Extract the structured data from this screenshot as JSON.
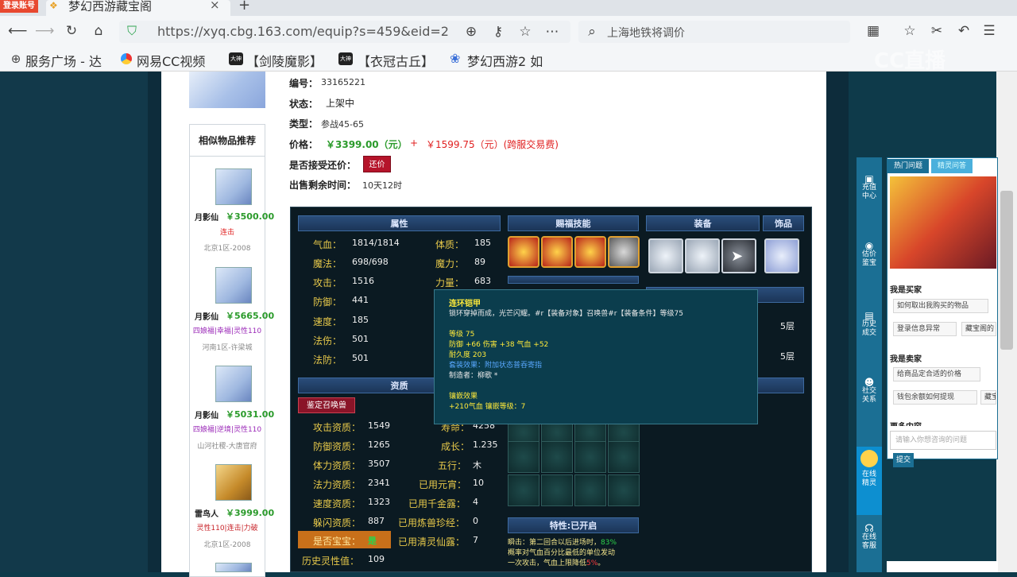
{
  "browser": {
    "tab_title": "梦幻西游藏宝阁",
    "login_badge": "登录账号",
    "url": "https://xyq.cbg.163.com/equip?s=459&eid=2",
    "search_text": "上海地铁将调价",
    "bookmarks": [
      "服务广场 - 达",
      "网易CC视频",
      "【剑陵魔影】",
      "【衣冠古丘】",
      "梦幻西游2 如"
    ],
    "watermark": "CC直播"
  },
  "item": {
    "id_label": "编号：",
    "id_value": "33165221",
    "status_label": "状态：",
    "status_value": "上架中",
    "type_label": "类型：",
    "type_value": "参战45-65",
    "price_label": "价格：",
    "price_value": "￥3399.00（元）",
    "price_plus": "+",
    "price_fee": "￥1599.75（元）(跨服交易费)",
    "counter_label": "是否接受还价：",
    "counter_button": "还价",
    "time_label": "出售剩余时间：",
    "time_value": "10天12时"
  },
  "similar": {
    "title": "相似物品推荐",
    "items": [
      {
        "name": "月影仙",
        "price": "￥3500.00",
        "tags": "连击",
        "server": "北京1区-2008"
      },
      {
        "name": "月影仙",
        "price": "￥5665.00",
        "tags": "四娘福|幸福|灵性110",
        "server": "河南1区-许梁城"
      },
      {
        "name": "月影仙",
        "price": "￥5031.00",
        "tags": "四娘福|逆境|灵性110",
        "server": "山河社稷-大唐官府"
      },
      {
        "name": "雷鸟人",
        "price": "￥3999.00",
        "tags": "灵性110|连击|力破",
        "server": "北京1区-2008"
      }
    ]
  },
  "panel": {
    "headers": {
      "attr": "属性",
      "skill": "赐福技能",
      "equip": "装备",
      "ornament": "饰品",
      "aptitude": "资质",
      "special": "特性:已开启"
    },
    "attrs": [
      [
        "气血：",
        "1814/1814"
      ],
      [
        "魔法：",
        "698/698"
      ],
      [
        "攻击：",
        "1516"
      ],
      [
        "防御：",
        "441"
      ],
      [
        "速度：",
        "185"
      ],
      [
        "法伤：",
        "501"
      ],
      [
        "法防：",
        "501"
      ]
    ],
    "attrs2": [
      [
        "体质：",
        "185"
      ],
      [
        "魔力：",
        "89"
      ],
      [
        "力量：",
        "683"
      ]
    ],
    "appraise_button": "鉴定召唤兽",
    "aptitudes": [
      [
        "攻击资质：",
        "1549"
      ],
      [
        "防御资质：",
        "1265"
      ],
      [
        "体力资质：",
        "3507"
      ],
      [
        "法力资质：",
        "2341"
      ],
      [
        "速度资质：",
        "1323"
      ],
      [
        "躲闪资质：",
        "887"
      ]
    ],
    "aptitudes2": [
      [
        "寿命：",
        "4258"
      ],
      [
        "成长：",
        "1.235"
      ],
      [
        "五行：",
        "木"
      ],
      [
        "已用元宵：",
        "10"
      ],
      [
        "已用千金露：",
        "4"
      ],
      [
        "已用炼兽珍经：",
        "0"
      ],
      [
        "已用清灵仙露：",
        "7"
      ]
    ],
    "baby_label": "是否宝宝：",
    "baby_value": "是",
    "history_label": "历史灵性值：",
    "history_value": "109",
    "layers": [
      "5层",
      "5层"
    ],
    "special_lines": [
      "瞬击：第二回合以后进场时，",
      "83%",
      "概率对气血百分比最低的单位发动",
      "一次攻击，气血上限降低",
      "5%",
      "。"
    ]
  },
  "tooltip": {
    "title": "连环铠甲",
    "desc": "锁环穿掉而成，光芒闪耀。#r【装备对象】召唤兽#r【装备条件】等级75",
    "level": "等级 75",
    "stats": "防御 +66 伤害 +38 气血 +52",
    "durability": "耐久度 203",
    "set": "套装效果：附加状态普吞寄指",
    "maker": "制造者：柳歌 *",
    "inlay_title": "镶嵌效果",
    "inlay": "+210气血 镶嵌等级：7"
  },
  "right": {
    "side_buttons": [
      [
        "充值",
        "中心"
      ],
      [
        "估价",
        "鉴宝"
      ],
      [
        "历史",
        "成交"
      ],
      [
        "社交",
        "关系"
      ],
      [
        "在线",
        "精灵"
      ],
      [
        "在线",
        "客服"
      ]
    ],
    "tabs": [
      "热门问题",
      "精灵问答"
    ],
    "buyer_title": "我是买家",
    "buyer_qs": [
      "如何取出我购买的物品",
      "登录信息异常",
      "藏宝阁的"
    ],
    "seller_title": "我是卖家",
    "seller_qs": [
      "给商品定合适的价格",
      "钱包余额如何提现",
      "藏宝"
    ],
    "more_title": "更多内容",
    "ask_placeholder": "请输入你想咨询的问题",
    "submit": "提交"
  },
  "colors": {
    "price_red": "#e01f1f",
    "price_green": "#2a9a2a",
    "panel_bg": "#0b1a22",
    "accent": "#1b6f94"
  }
}
